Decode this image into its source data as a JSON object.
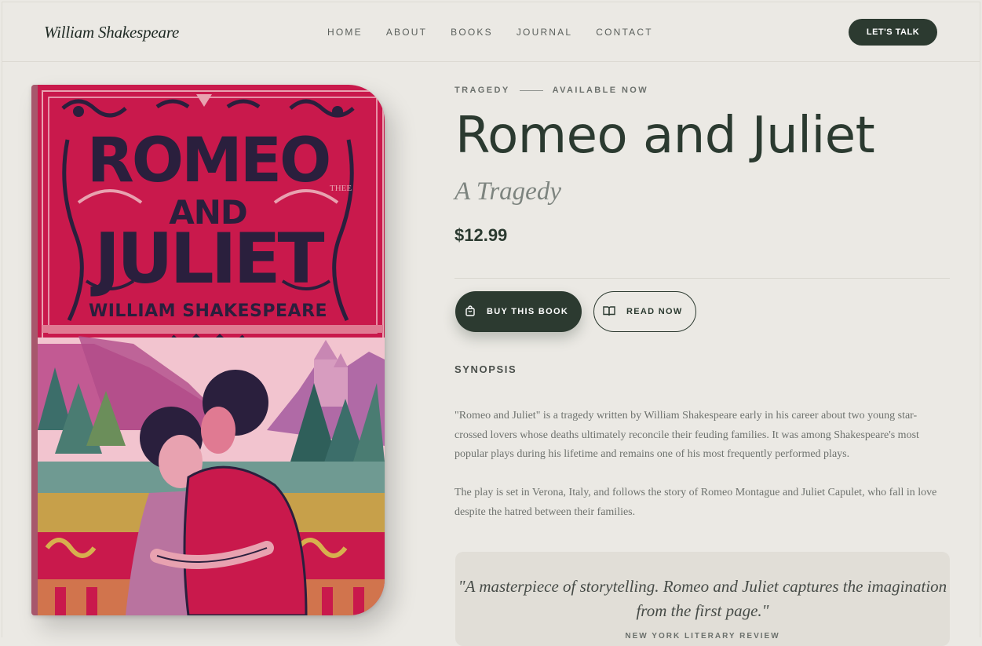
{
  "header": {
    "logo": "William Shakespeare",
    "nav": [
      "HOME",
      "ABOUT",
      "BOOKS",
      "JOURNAL",
      "CONTACT"
    ],
    "cta": "LET'S TALK"
  },
  "cover": {
    "title_line1": "ROMEO",
    "title_line2": "AND",
    "title_line3": "JULIET",
    "author": "WILLIAM SHAKESPEARE",
    "mark": "THEE"
  },
  "book": {
    "genre": "TRAGEDY",
    "availability": "AVAILABLE NOW",
    "title": "Romeo and Juliet",
    "subtitle": "A Tragedy",
    "price": "$12.99",
    "buy_label": "BUY THIS BOOK",
    "read_label": "READ NOW"
  },
  "synopsis": {
    "heading": "SYNOPSIS",
    "paragraphs": [
      "\"Romeo and Juliet\" is a tragedy written by William Shakespeare early in his career about two young star-crossed lovers whose deaths ultimately reconcile their feuding families. It was among Shakespeare's most popular plays during his lifetime and remains one of his most frequently performed plays.",
      "The play is set in Verona, Italy, and follows the story of Romeo Montague and Juliet Capulet, who fall in love despite the hatred between their families."
    ]
  },
  "review": {
    "quote": "\"A masterpiece of storytelling. Romeo and Juliet captures the imagination from the first page.\"",
    "source": "NEW YORK LITERARY REVIEW"
  },
  "colors": {
    "background": "#ebe9e4",
    "primary": "#2c3a30",
    "cover_red": "#c9194c",
    "cover_ink": "#2a1f3d"
  },
  "icons": {
    "buy": "shopping-bag-icon",
    "read": "open-book-icon"
  }
}
